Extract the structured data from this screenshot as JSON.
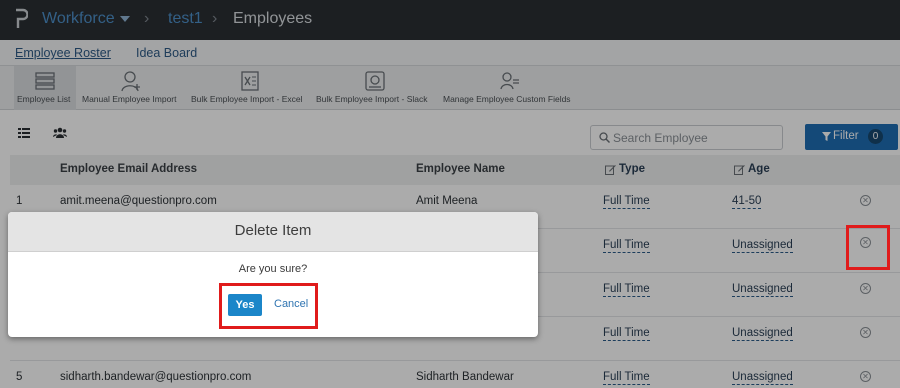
{
  "breadcrumb": {
    "workforce": "Workforce",
    "sep": "›",
    "project": "test1",
    "page": "Employees"
  },
  "subnav": {
    "roster": "Employee Roster",
    "idea": "Idea Board"
  },
  "toolbar": [
    {
      "label": "Employee List",
      "icon": "list-icon"
    },
    {
      "label": "Manual Employee Import",
      "icon": "add-user-icon"
    },
    {
      "label": "Bulk Employee Import - Excel",
      "icon": "excel-icon"
    },
    {
      "label": "Bulk Employee Import - Slack",
      "icon": "slack-icon"
    },
    {
      "label": "Manage Employee Custom Fields",
      "icon": "custom-fields-icon"
    }
  ],
  "search": {
    "placeholder": "Search Employee"
  },
  "filter": {
    "label": "Filter",
    "count": "0"
  },
  "table": {
    "headers": {
      "email": "Employee Email Address",
      "name": "Employee Name",
      "type": "Type",
      "age": "Age"
    },
    "rows": [
      {
        "num": "1",
        "email": "amit.meena@questionpro.com",
        "name": "Amit Meena",
        "type": "Full Time",
        "age": "41-50"
      },
      {
        "num": "",
        "email": "",
        "name": "",
        "type": "Full Time",
        "age": "Unassigned"
      },
      {
        "num": "",
        "email": "",
        "name": "",
        "type": "Full Time",
        "age": "Unassigned"
      },
      {
        "num": "",
        "email": "",
        "name": "",
        "type": "Full Time",
        "age": "Unassigned"
      },
      {
        "num": "5",
        "email": "sidharth.bandewar@questionpro.com",
        "name": "Sidharth Bandewar",
        "type": "Full Time",
        "age": "Unassigned"
      }
    ]
  },
  "modal": {
    "title": "Delete Item",
    "message": "Are you sure?",
    "yes": "Yes",
    "cancel": "Cancel"
  },
  "colors": {
    "topbar": "#2b2f33",
    "accent": "#1e6db3",
    "highlight": "#e01b1b"
  }
}
